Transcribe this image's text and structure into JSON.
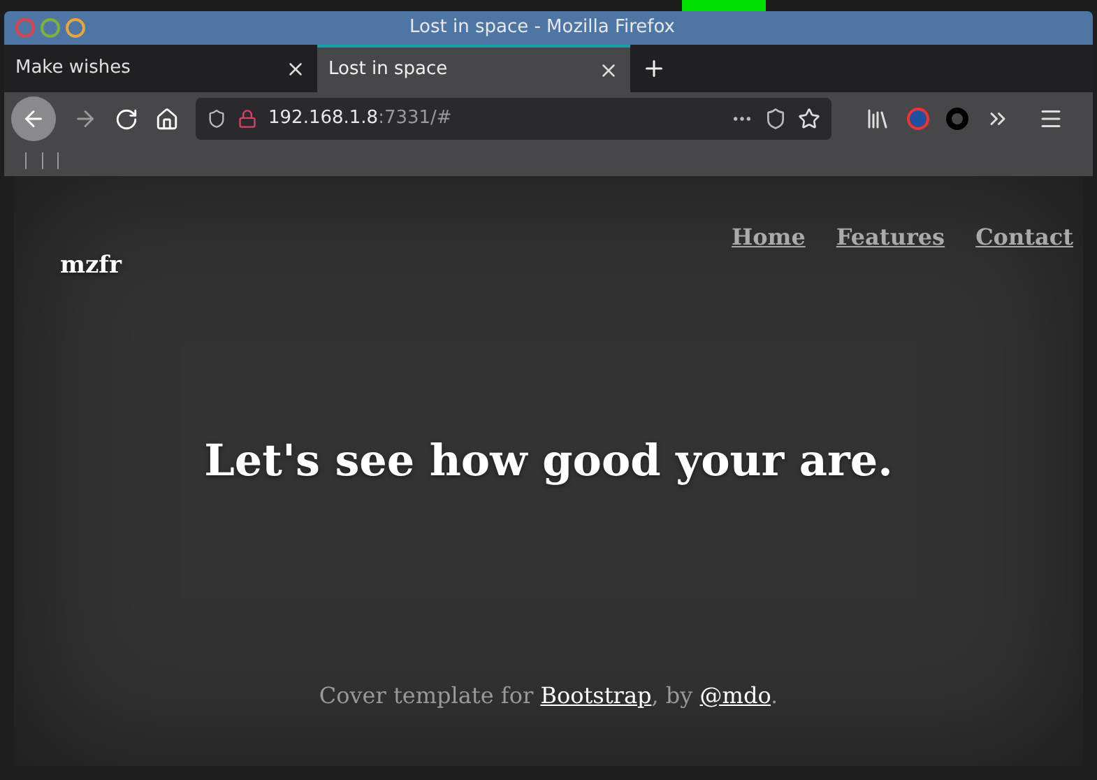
{
  "window": {
    "title": "Lost in space - Mozilla Firefox"
  },
  "tabs": [
    {
      "label": "Make wishes",
      "selected": false
    },
    {
      "label": "Lost in space",
      "selected": true
    }
  ],
  "url": {
    "host": "192.168.1.8",
    "rest": ":7331/#"
  },
  "page": {
    "brand": "mzfr",
    "nav": [
      "Home",
      "Features",
      "Contact"
    ],
    "heading": "Let's see how good your are.",
    "footer": {
      "before": "Cover template for ",
      "link1": "Bootstrap",
      "middle": ", by ",
      "link2": "@mdo",
      "after": "."
    }
  }
}
